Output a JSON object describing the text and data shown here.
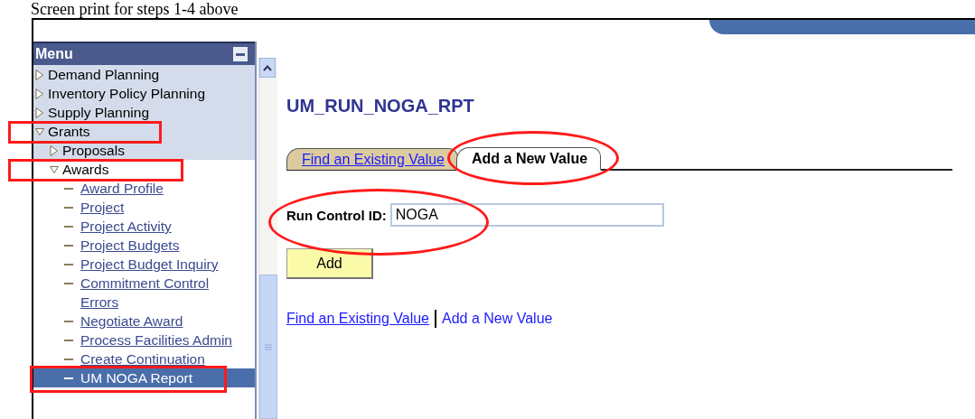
{
  "caption": "Screen print for steps 1-4 above",
  "menu": {
    "title": "Menu",
    "items": [
      {
        "label": "Demand Planning",
        "expanded": false,
        "selected": false,
        "boxed": false
      },
      {
        "label": "Inventory Policy Planning",
        "expanded": false,
        "selected": false,
        "boxed": false
      },
      {
        "label": "Supply Planning",
        "expanded": false,
        "selected": false,
        "boxed": false
      },
      {
        "label": "Grants",
        "expanded": true,
        "selected": false,
        "boxed": true,
        "children": [
          {
            "label": "Proposals",
            "expanded": false,
            "selected": false,
            "boxed": false
          },
          {
            "label": "Awards",
            "expanded": true,
            "selected": false,
            "boxed": true,
            "children": [
              {
                "label": "Award Profile",
                "selected": false,
                "boxed": false
              },
              {
                "label": "Project",
                "selected": false,
                "boxed": false
              },
              {
                "label": "Project Activity",
                "selected": false,
                "boxed": false
              },
              {
                "label": "Project Budgets",
                "selected": false,
                "boxed": false
              },
              {
                "label": "Project Budget Inquiry",
                "selected": false,
                "boxed": false
              },
              {
                "label": "Commitment Control Errors",
                "selected": false,
                "boxed": false
              },
              {
                "label": "Negotiate Award",
                "selected": false,
                "boxed": false
              },
              {
                "label": "Process Facilities Admin",
                "selected": false,
                "boxed": false
              },
              {
                "label": "Create Continuation",
                "selected": false,
                "boxed": false
              },
              {
                "label": "UM NOGA Report",
                "selected": true,
                "boxed": true
              }
            ]
          }
        ]
      }
    ]
  },
  "page_title": "UM_RUN_NOGA_RPT",
  "tabs": [
    {
      "label": "Find an Existing Value",
      "selected": false,
      "circled": false
    },
    {
      "label": "Add a New Value",
      "selected": true,
      "circled": true
    }
  ],
  "run_control": {
    "label": "Run Control ID:",
    "value": "NOGA",
    "circled": true
  },
  "add_button": "Add",
  "links": [
    {
      "label": "Find an Existing Value",
      "underlined": true
    },
    {
      "label": "Add a New Value",
      "underlined": false
    }
  ]
}
